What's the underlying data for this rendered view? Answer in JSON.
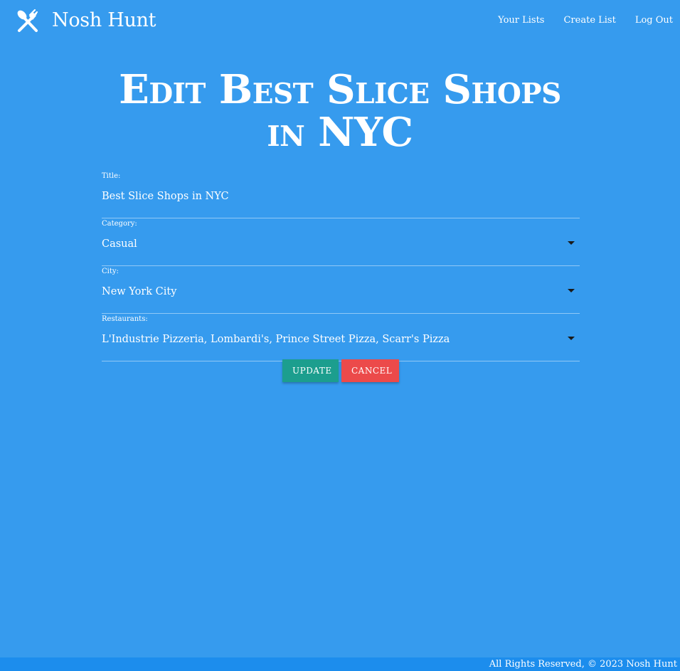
{
  "nav": {
    "brand": "Nosh Hunt",
    "brand_icon": "fork-spoon-icon",
    "links": [
      "Your Lists",
      "Create List",
      "Log Out"
    ]
  },
  "page": {
    "title": "Edit Best Slice Shops in NYC"
  },
  "form": {
    "title_label": "Title:",
    "title_value": "Best Slice Shops in NYC",
    "category_label": "Category:",
    "category_value": "Casual",
    "city_label": "City:",
    "city_value": "New York City",
    "restaurants_label": "Restaurants:",
    "restaurants_value": "L'Industrie Pizzeria, Lombardi's, Prince Street Pizza, Scarr's Pizza"
  },
  "actions": {
    "update": "Update",
    "cancel": "Cancel"
  },
  "footer": {
    "text": "All Rights Reserved, © 2023 Nosh Hunt"
  },
  "colors": {
    "background": "#369BEE",
    "footer": "#1C8DED",
    "update_button": "#1C9E8E",
    "cancel_button": "#EC4A4A"
  }
}
